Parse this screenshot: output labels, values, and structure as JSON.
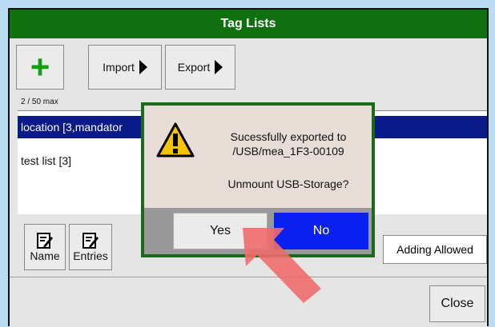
{
  "window": {
    "title": "Tag Lists"
  },
  "toolbar": {
    "import_label": "Import",
    "export_label": "Export",
    "count": "2 / 50 max"
  },
  "list": {
    "items": [
      {
        "label": "location [3,mandator"
      },
      {
        "label": "test list [3]"
      }
    ]
  },
  "bottom": {
    "name_label": "Name",
    "entries_label": "Entries",
    "adding_label": "Adding Allowed"
  },
  "footer": {
    "close_label": "Close"
  },
  "dialog": {
    "message_line1": "Sucessfully exported to",
    "message_line2": "/USB/mea_1F3-00109",
    "question": "Unmount USB-Storage?",
    "yes_label": "Yes",
    "no_label": "No"
  },
  "colors": {
    "title_bar": "#107010",
    "selection": "#0a1a88",
    "no_button": "#0a20f0",
    "dialog_border": "#1a6a1a",
    "arrow": "#f06b6b"
  },
  "icons": {
    "add": "plus-icon",
    "import": "triangle-right-icon",
    "export": "triangle-right-icon",
    "name": "edit-icon",
    "entries": "edit-icon",
    "dialog": "warning-icon",
    "annotation": "arrow-icon"
  }
}
